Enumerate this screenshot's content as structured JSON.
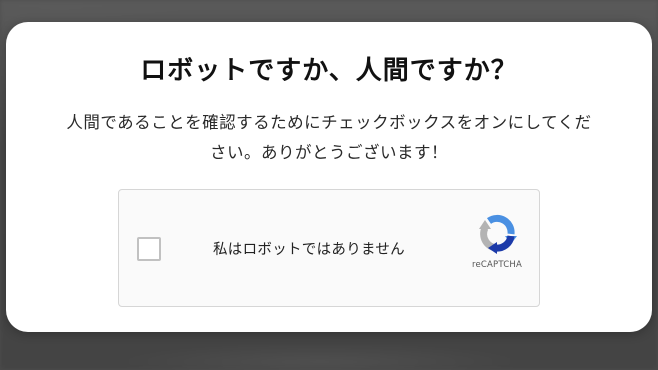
{
  "dialog": {
    "title": "ロボットですか、人間ですか？",
    "description_line1": "人間であることを確認するためにチェックボックスをオンにしてくだ",
    "description_line2": "さい。ありがとうございます！"
  },
  "recaptcha": {
    "checkbox_label": "私はロボットではありません",
    "checked": false,
    "logo_text": "reCAPTCHA",
    "logo_icon": "recaptcha-logo-icon"
  },
  "colors": {
    "recaptcha_blue": "#4a90e2",
    "recaptcha_darkblue": "#1c3aa9",
    "recaptcha_gray": "#b3b3b3"
  }
}
